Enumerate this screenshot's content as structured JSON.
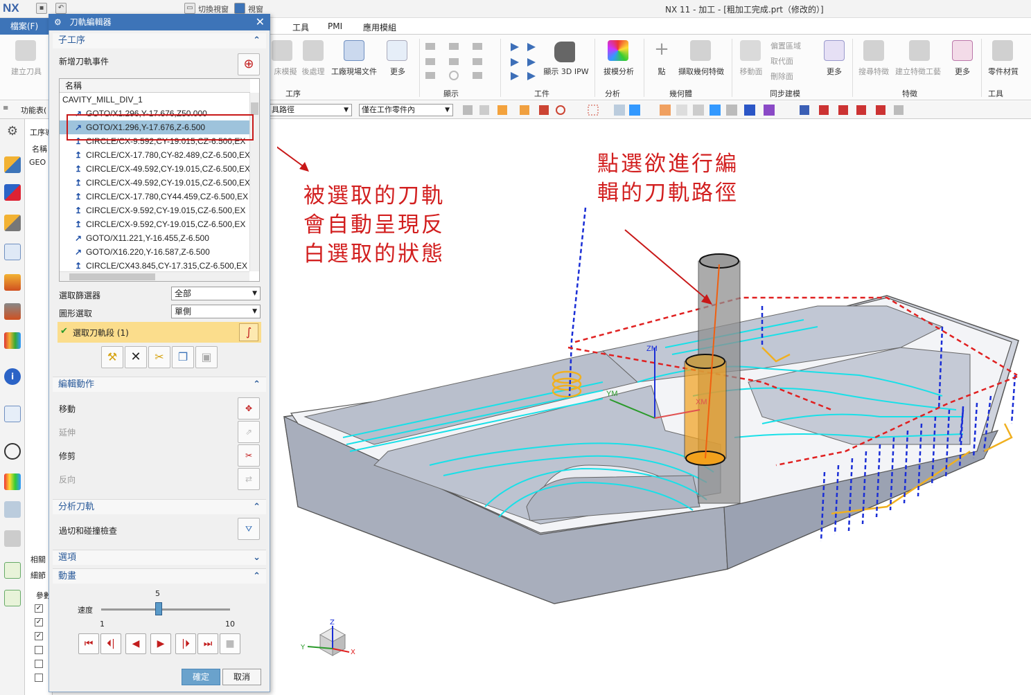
{
  "window": {
    "logo": "NX",
    "title": "NX 11 - 加工 - [粗加工完成.prt（修改的）]",
    "quick_access": {
      "switch_window": "切換視窗",
      "window_menu": "視窗"
    }
  },
  "menubar": {
    "file": "檔案(F)",
    "items": [
      "工具",
      "PMI",
      "應用模組"
    ]
  },
  "ribbon": {
    "buttons": [
      {
        "label": "建立刀具"
      },
      {
        "label": "床模擬"
      },
      {
        "label": "後處理"
      },
      {
        "label": "工廠現場文件"
      },
      {
        "label": "更多"
      },
      {
        "label": "顯示 3D IPW"
      },
      {
        "label": "拔模分析"
      },
      {
        "label": "點"
      },
      {
        "label": "擷取幾何特徵"
      },
      {
        "label": "移動面"
      },
      {
        "label": "更多"
      },
      {
        "label": "搜尋特徵"
      },
      {
        "label": "建立特徵工藝"
      },
      {
        "label": "更多"
      },
      {
        "label": "零件材質"
      }
    ],
    "sync_items": [
      "偏置區域",
      "取代面",
      "刪除面"
    ],
    "groups": [
      "工序",
      "顯示",
      "工件",
      "分析",
      "幾何體",
      "同步建模",
      "特徵",
      "工具"
    ]
  },
  "toolbar2": {
    "menu_label": "功能表(",
    "filter_value": "具路徑",
    "scope_value": "僅在工作零件內"
  },
  "navigator": {
    "title": "工序導",
    "col_name": "名稱",
    "row1": "GEO",
    "related": "相關",
    "details": "細節",
    "param": "參數"
  },
  "dialog": {
    "title": "刀軌編輯器",
    "subop": {
      "heading": "子工序",
      "new_event": "新增刀軌事件",
      "list_header": "名稱",
      "list_root": "CAVITY_MILL_DIV_1",
      "items": [
        {
          "icon": "goto",
          "text": "GOTO/X1.296,Y-17.676,Z50.000"
        },
        {
          "icon": "goto",
          "text": "GOTO/X1.296,Y-17.676,Z-6.500",
          "selected": true
        },
        {
          "icon": "circle",
          "text": "CIRCLE/CX-9.592,CY-19.015,CZ-6.500,EX"
        },
        {
          "icon": "circle",
          "text": "CIRCLE/CX-17.780,CY-82.489,CZ-6.500,EX"
        },
        {
          "icon": "circle",
          "text": "CIRCLE/CX-49.592,CY-19.015,CZ-6.500,EX"
        },
        {
          "icon": "circle",
          "text": "CIRCLE/CX-49.592,CY-19.015,CZ-6.500,EX"
        },
        {
          "icon": "circle",
          "text": "CIRCLE/CX-17.780,CY44.459,CZ-6.500,EX"
        },
        {
          "icon": "circle",
          "text": "CIRCLE/CX-9.592,CY-19.015,CZ-6.500,EX"
        },
        {
          "icon": "circle",
          "text": "CIRCLE/CX-9.592,CY-19.015,CZ-6.500,EX"
        },
        {
          "icon": "goto",
          "text": "GOTO/X11.221,Y-16.455,Z-6.500"
        },
        {
          "icon": "goto",
          "text": "GOTO/X16.220,Y-16.587,Z-6.500"
        },
        {
          "icon": "circle",
          "text": "CIRCLE/CX43.845,CY-17.315,CZ-6.500,EX"
        }
      ],
      "filter_label": "選取篩選器",
      "filter_value": "全部",
      "shape_label": "圖形選取",
      "shape_value": "單側",
      "selected_label": "選取刀軌段 (1)"
    },
    "edit": {
      "heading": "編輯動作",
      "move": "移動",
      "extend": "延伸",
      "trim": "修剪",
      "reverse": "反向"
    },
    "analyze": {
      "heading": "分析刀軌",
      "gouge": "過切和碰撞檢查"
    },
    "options_heading": "選項",
    "animation": {
      "heading": "動畫",
      "speed_label": "速度",
      "speed_value": "5",
      "speed_min": "1",
      "speed_max": "10",
      "speed": 5,
      "range": [
        1,
        10
      ]
    },
    "ok": "確定",
    "cancel": "取消"
  },
  "annotations": {
    "left": [
      "被選取的刀軌",
      "會自動呈現反",
      "白選取的狀態"
    ],
    "right": [
      "點選欲進行編",
      "輯的刀軌路徑"
    ],
    "color": "#d21f1f"
  },
  "viewport": {
    "axes": {
      "zm": "ZM",
      "ym": "YM",
      "xm": "XM"
    },
    "triad": {
      "x": "X",
      "y": "Y",
      "z": "Z"
    },
    "toolpath_color": "#18e0e8",
    "engage_color": "#f0b020",
    "rapid_color": "#1a2ed6",
    "cutter_color": "#f2a11d"
  }
}
